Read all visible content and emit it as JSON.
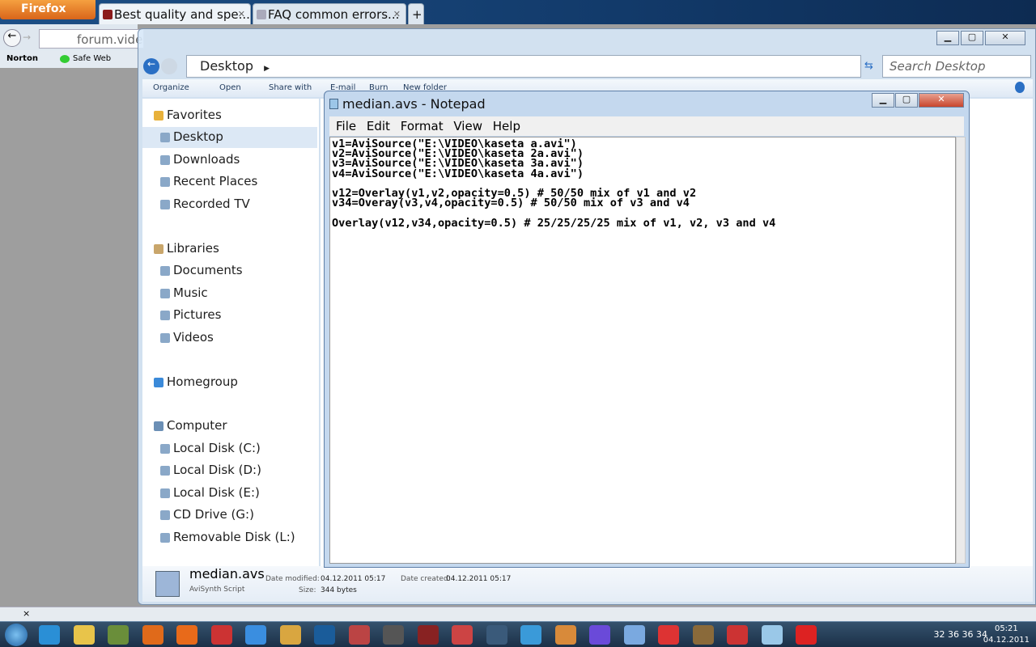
{
  "firefox": {
    "menu": "Firefox",
    "tabs": [
      {
        "label": "Best quality and spe..."
      },
      {
        "label": "FAQ common errors..."
      }
    ],
    "new_tab": "+",
    "url": "forum.vide",
    "bookmarks": [
      "Norton",
      "Safe Web"
    ],
    "addon_close": "×"
  },
  "explorer": {
    "location": "Desktop",
    "search_placeholder": "Search Desktop",
    "toolbar": [
      "Organize",
      "Open",
      "Share with",
      "E-mail",
      "Burn",
      "New folder"
    ],
    "nav": [
      {
        "label": "Favorites",
        "h": true
      },
      {
        "label": "Desktop"
      },
      {
        "label": "Downloads"
      },
      {
        "label": "Recent Places"
      },
      {
        "label": "Recorded TV"
      },
      {
        "label": "Libraries",
        "h": true
      },
      {
        "label": "Documents"
      },
      {
        "label": "Music"
      },
      {
        "label": "Pictures"
      },
      {
        "label": "Videos"
      },
      {
        "label": "Homegroup",
        "h": true
      },
      {
        "label": "Computer",
        "h": true
      },
      {
        "label": "Local Disk (C:)"
      },
      {
        "label": "Local Disk (D:)"
      },
      {
        "label": "Local Disk (E:)"
      },
      {
        "label": "CD Drive (G:)"
      },
      {
        "label": "Removable Disk (L:)"
      }
    ],
    "details": {
      "name": "median.avs",
      "type": "AviSynth Script",
      "modified_label": "Date modified:",
      "modified": "04.12.2011 05:17",
      "created_label": "Date created:",
      "created": "04.12.2011 05:17",
      "size_label": "Size:",
      "size": "344 bytes"
    }
  },
  "notepad": {
    "title": "median.avs - Notepad",
    "menu": [
      "File",
      "Edit",
      "Format",
      "View",
      "Help"
    ],
    "text": "v1=AviSource(\"E:\\VIDEO\\kaseta a.avi\")\nv2=AviSource(\"E:\\VIDEO\\kaseta 2a.avi\")\nv3=AviSource(\"E:\\VIDEO\\kaseta 3a.avi\")\nv4=AviSource(\"E:\\VIDEO\\kaseta 4a.avi\")\n\nv12=Overlay(v1,v2,opacity=0.5) # 50/50 mix of v1 and v2\nv34=Overay(v3,v4,opacity=0.5) # 50/50 mix of v3 and v4\n\nOverlay(v12,v34,opacity=0.5) # 25/25/25/25 mix of v1, v2, v3 and v4"
  },
  "taskbar": {
    "temps": "32  36  36  34",
    "time": "05:21",
    "date": "04.12.2011",
    "icons": [
      "#2a8fd6",
      "#e8c44a",
      "#6a8e3a",
      "#e06a1a",
      "#e86a1a",
      "#c33",
      "#3a8ee0",
      "#d9a640",
      "#1a5c9a",
      "#b44",
      "#555",
      "#822",
      "#c44",
      "#3a5a7a",
      "#3a9ad9",
      "#d88a3a",
      "#6a4ad9",
      "#7aa9e0",
      "#d33",
      "#8a6a3a",
      "#c33",
      "#9ac8e8",
      "#d22"
    ]
  }
}
